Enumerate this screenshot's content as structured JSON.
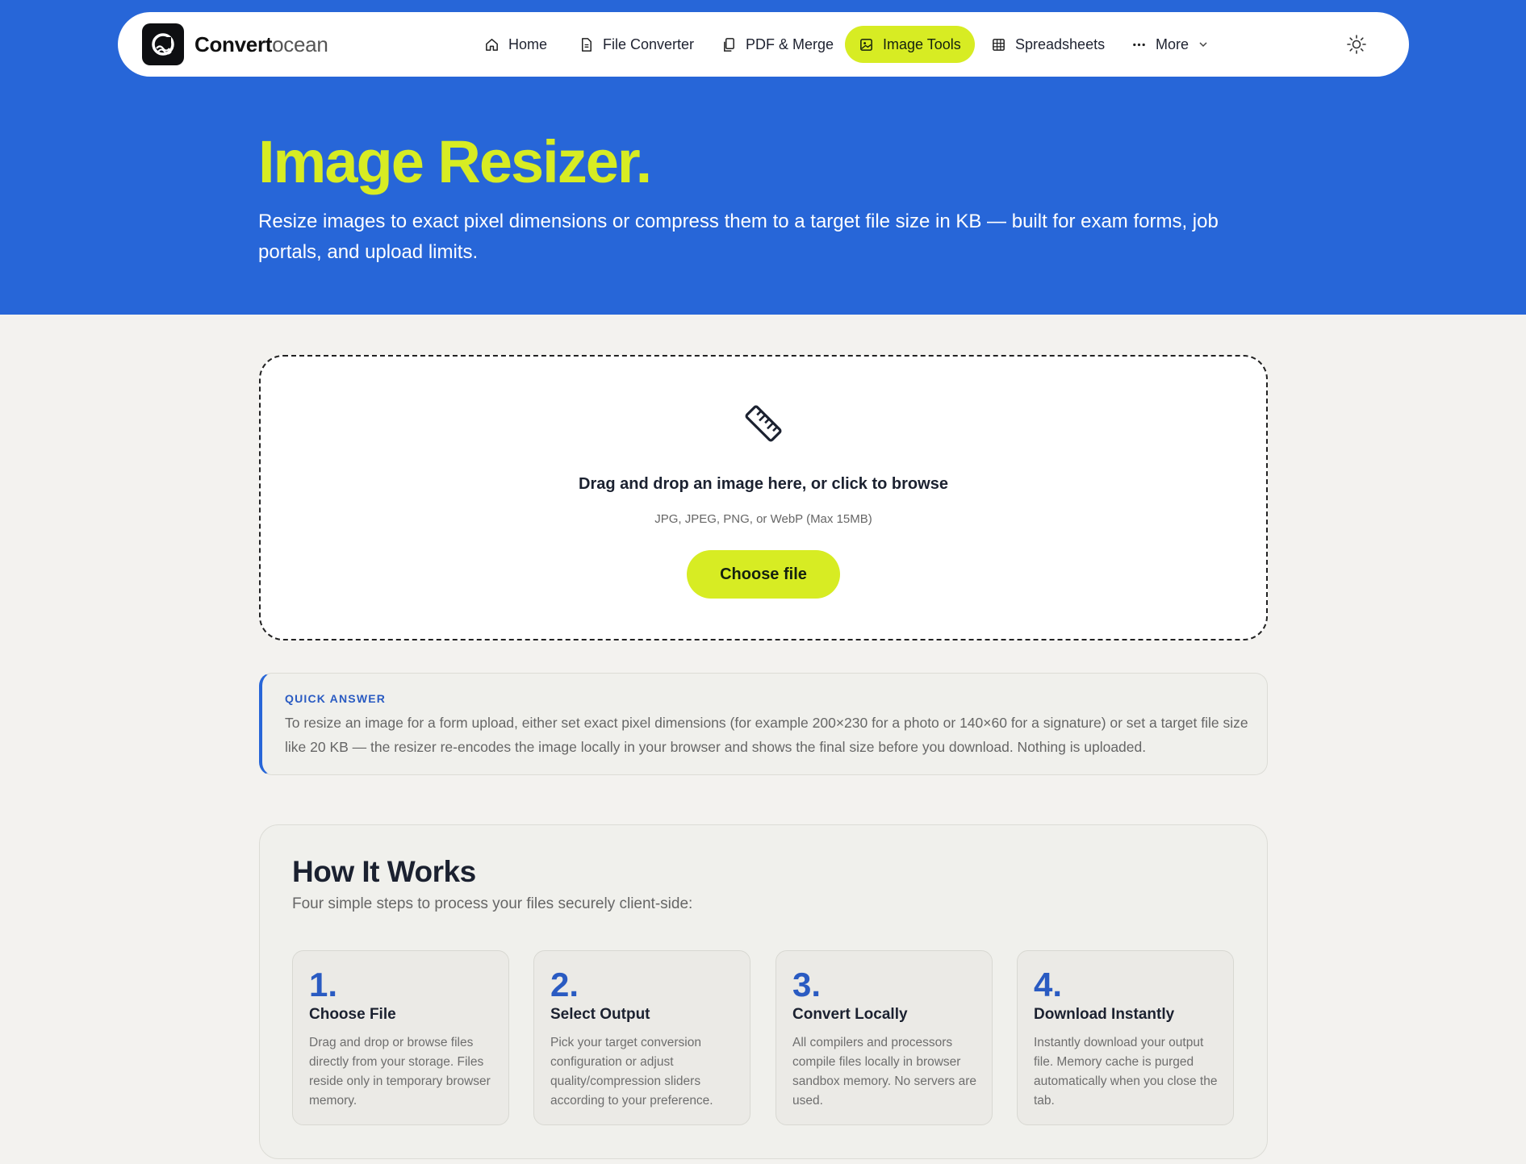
{
  "brand": {
    "bold": "Convert",
    "light": "ocean"
  },
  "nav": {
    "items": [
      {
        "label": "Home",
        "icon": "home-icon"
      },
      {
        "label": "File Converter",
        "icon": "file-icon"
      },
      {
        "label": "PDF & Merge",
        "icon": "copy-icon"
      },
      {
        "label": "Image Tools",
        "icon": "image-icon",
        "active": true
      },
      {
        "label": "Spreadsheets",
        "icon": "grid-icon"
      },
      {
        "label": "More",
        "icon": "dots-icon"
      }
    ],
    "theme_toggle_icon": "sun-icon"
  },
  "hero": {
    "title": "Image Resizer.",
    "subtitle": "Resize images to exact pixel dimensions or compress them to a target file size in KB — built for exam forms, job portals, and upload limits."
  },
  "dropzone": {
    "icon": "ruler-icon",
    "title": "Drag and drop an image here, or click to browse",
    "formats": "JPG, JPEG, PNG, or WebP (Max 15MB)",
    "button": "Choose file"
  },
  "quick_answer": {
    "label": "QUICK ANSWER",
    "text": "To resize an image for a form upload, either set exact pixel dimensions (for example 200×230 for a photo or 140×60 for a signature) or set a target file size like 20 KB — the resizer re-encodes the image locally in your browser and shows the final size before you download. Nothing is uploaded."
  },
  "how_it_works": {
    "title": "How It Works",
    "subtitle": "Four simple steps to process your files securely client-side:",
    "steps": [
      {
        "num": "1.",
        "title": "Choose File",
        "text": "Drag and drop or browse files directly from your storage. Files reside only in temporary browser memory."
      },
      {
        "num": "2.",
        "title": "Select Output",
        "text": "Pick your target conversion configuration or adjust quality/compression sliders according to your preference."
      },
      {
        "num": "3.",
        "title": "Convert Locally",
        "text": "All compilers and processors compile files locally in browser sandbox memory. No servers are used."
      },
      {
        "num": "4.",
        "title": "Download Instantly",
        "text": "Instantly download your output file. Memory cache is purged automatically when you close the tab."
      }
    ]
  },
  "colors": {
    "hero_bg": "#2766d8",
    "accent": "#d7ec23",
    "step_number": "#2a5bc2"
  }
}
